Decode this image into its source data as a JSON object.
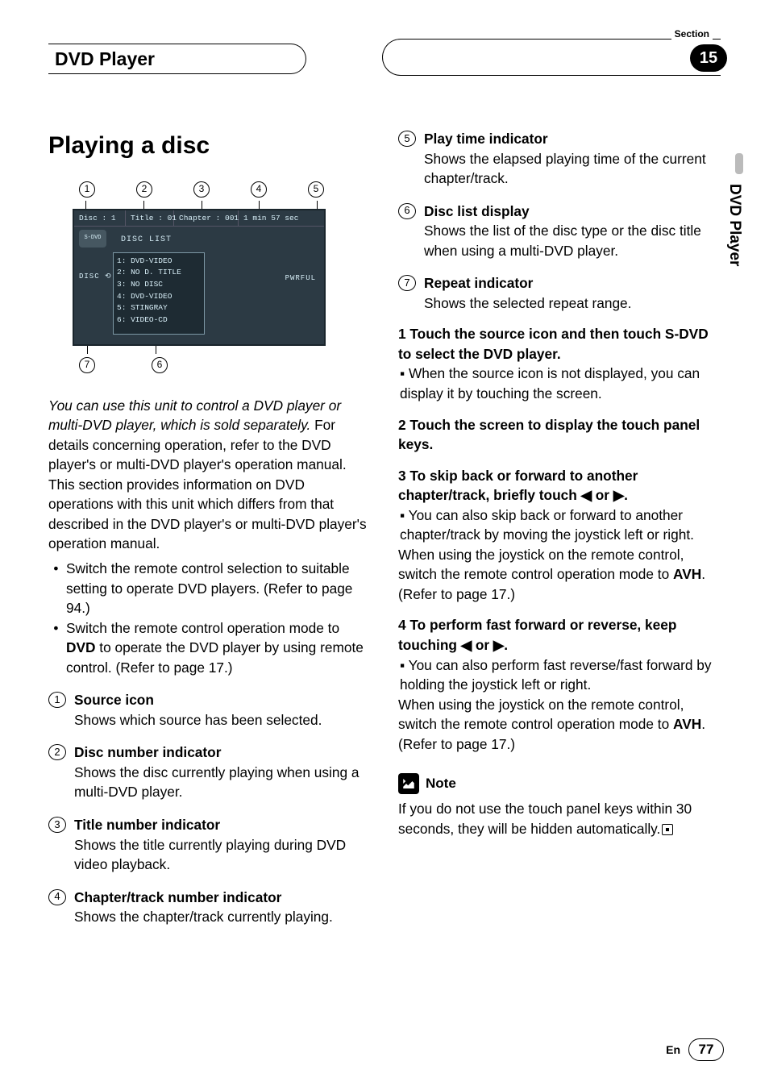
{
  "header": {
    "left_title": "DVD Player",
    "section_label": "Section",
    "section_number": "15",
    "side_tab": "DVD Player"
  },
  "left": {
    "h1": "Playing a disc",
    "callouts_top": [
      "1",
      "2",
      "3",
      "4",
      "5"
    ],
    "callouts_bot": [
      "7",
      "6"
    ],
    "screen": {
      "disc": "Disc : 1",
      "title": "Title : 01",
      "chapter": "Chapter : 001",
      "time": "1 min 57 sec",
      "src": "S-DVD",
      "disclist_label": "DISC LIST",
      "list": [
        "1: DVD-VIDEO",
        "2: NO D. TITLE",
        "3: NO DISC",
        "4: DVD-VIDEO",
        "5: STINGRAY",
        "6: VIDEO-CD"
      ],
      "repeat": "DISC ⟲",
      "pwrful": "PWRFUL"
    },
    "intro_italic": "You can use this unit to control a DVD player or multi-DVD player, which is sold separately.",
    "intro_rest": "For details concerning operation, refer to the DVD player's or multi-DVD player's operation manual. This section provides information on DVD operations with this unit which differs from that described in the DVD player's or multi-DVD player's operation manual.",
    "bullets": [
      "Switch the remote control selection to suitable setting to operate DVD players. (Refer to page 94.)",
      {
        "pre": "Switch the remote control operation mode to ",
        "bold": "DVD",
        "post": " to operate the DVD player by using remote control. (Refer to page 17.)"
      }
    ],
    "items": [
      {
        "n": "1",
        "head": "Source icon",
        "desc": "Shows which source has been selected."
      },
      {
        "n": "2",
        "head": "Disc number indicator",
        "desc": "Shows the disc currently playing when using a multi-DVD player."
      },
      {
        "n": "3",
        "head": "Title number indicator",
        "desc": "Shows the title currently playing during DVD video playback."
      },
      {
        "n": "4",
        "head": "Chapter/track number indicator",
        "desc": "Shows the chapter/track currently playing."
      }
    ]
  },
  "right": {
    "items_cont": [
      {
        "n": "5",
        "head": "Play time indicator",
        "desc": "Shows the elapsed playing time of the current chapter/track."
      },
      {
        "n": "6",
        "head": "Disc list display",
        "desc": "Shows the list of the disc type or the disc title when using a multi-DVD player."
      },
      {
        "n": "7",
        "head": "Repeat indicator",
        "desc": "Shows the selected repeat range."
      }
    ],
    "step1_head": "1    Touch the source icon and then touch S-DVD to select the DVD player.",
    "step1_bullet": "When the source icon is not displayed, you can display it by touching the screen.",
    "step2_head": "2    Touch the screen to display the touch panel keys.",
    "step3_head": "3    To skip back or forward to another chapter/track, briefly touch ◀ or ▶.",
    "step3_bullet": "You can also skip back or forward to another chapter/track by moving the joystick left or right.",
    "step3_para_pre": "When using the joystick on the remote control, switch the remote control operation mode to ",
    "step3_para_bold": "AVH",
    "step3_para_post": ". (Refer to page 17.)",
    "step4_head": "4    To perform fast forward or reverse, keep touching ◀ or ▶.",
    "step4_bullet": "You can also perform fast reverse/fast forward by holding the joystick left or right.",
    "step4_para_pre": "When using the joystick on the remote control, switch the remote control operation mode to ",
    "step4_para_bold": "AVH",
    "step4_para_post": ". (Refer to page 17.)",
    "note_label": "Note",
    "note_text": "If you do not use the touch panel keys within 30 seconds, they will be hidden automatically."
  },
  "footer": {
    "lang": "En",
    "page": "77"
  }
}
